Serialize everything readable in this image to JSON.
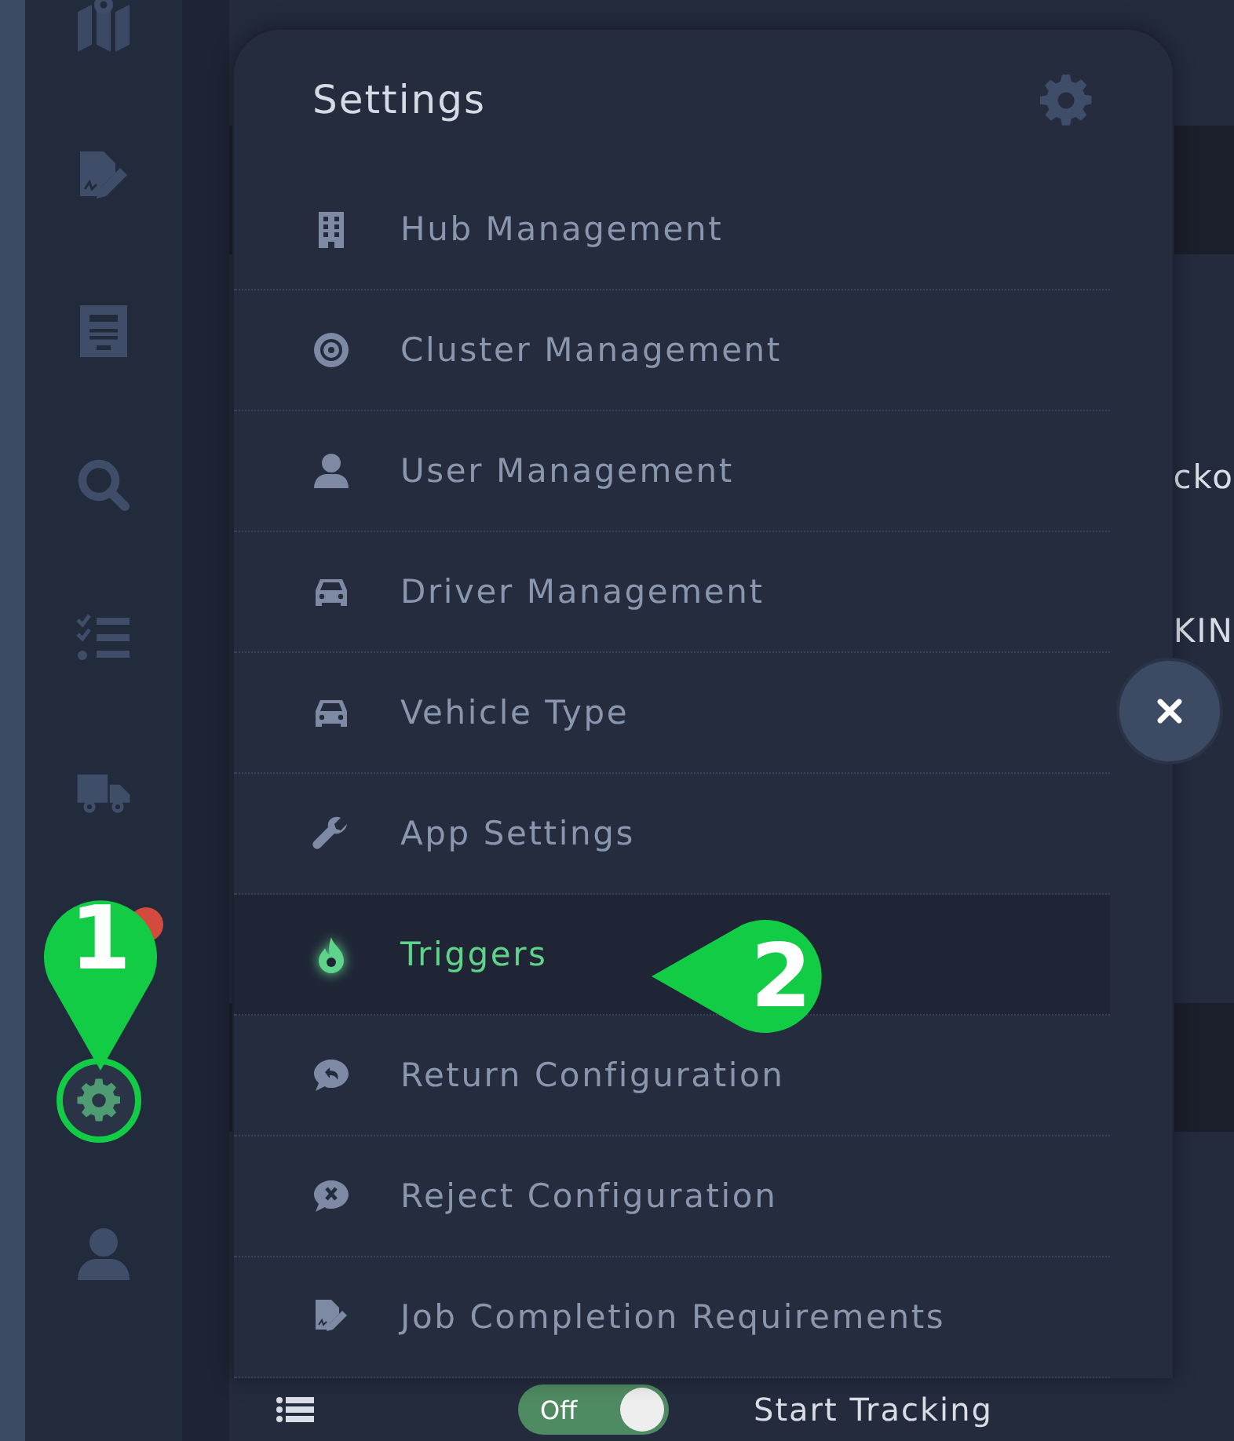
{
  "sidebar": {
    "items": [
      {
        "kind": "map",
        "selected": false
      },
      {
        "kind": "signature",
        "selected": false
      },
      {
        "kind": "document",
        "selected": false
      },
      {
        "kind": "search",
        "selected": false
      },
      {
        "kind": "checklist",
        "selected": false
      },
      {
        "kind": "truck",
        "selected": false
      },
      {
        "kind": "gear",
        "selected": true
      },
      {
        "kind": "user",
        "selected": false
      }
    ],
    "alert_dot": true
  },
  "background": {
    "fragments": [
      "cko",
      "KIN"
    ],
    "toggle": {
      "label": "Off",
      "on": true
    },
    "tracking_label": "Start Tracking"
  },
  "settings_menu": {
    "title": "Settings",
    "items": [
      {
        "label": "Hub Management",
        "selected": false
      },
      {
        "label": "Cluster Management",
        "selected": false
      },
      {
        "label": "User Management",
        "selected": false
      },
      {
        "label": "Driver Management",
        "selected": false
      },
      {
        "label": "Vehicle Type",
        "selected": false
      },
      {
        "label": "App Settings",
        "selected": false
      },
      {
        "label": "Triggers",
        "selected": true
      },
      {
        "label": "Return Configuration",
        "selected": false
      },
      {
        "label": "Reject Configuration",
        "selected": false
      },
      {
        "label": "Job Completion Requirements",
        "selected": false
      }
    ]
  },
  "annotations": [
    {
      "label": "1",
      "kind": "pin-down"
    },
    {
      "label": "2",
      "kind": "pin-left"
    }
  ]
}
